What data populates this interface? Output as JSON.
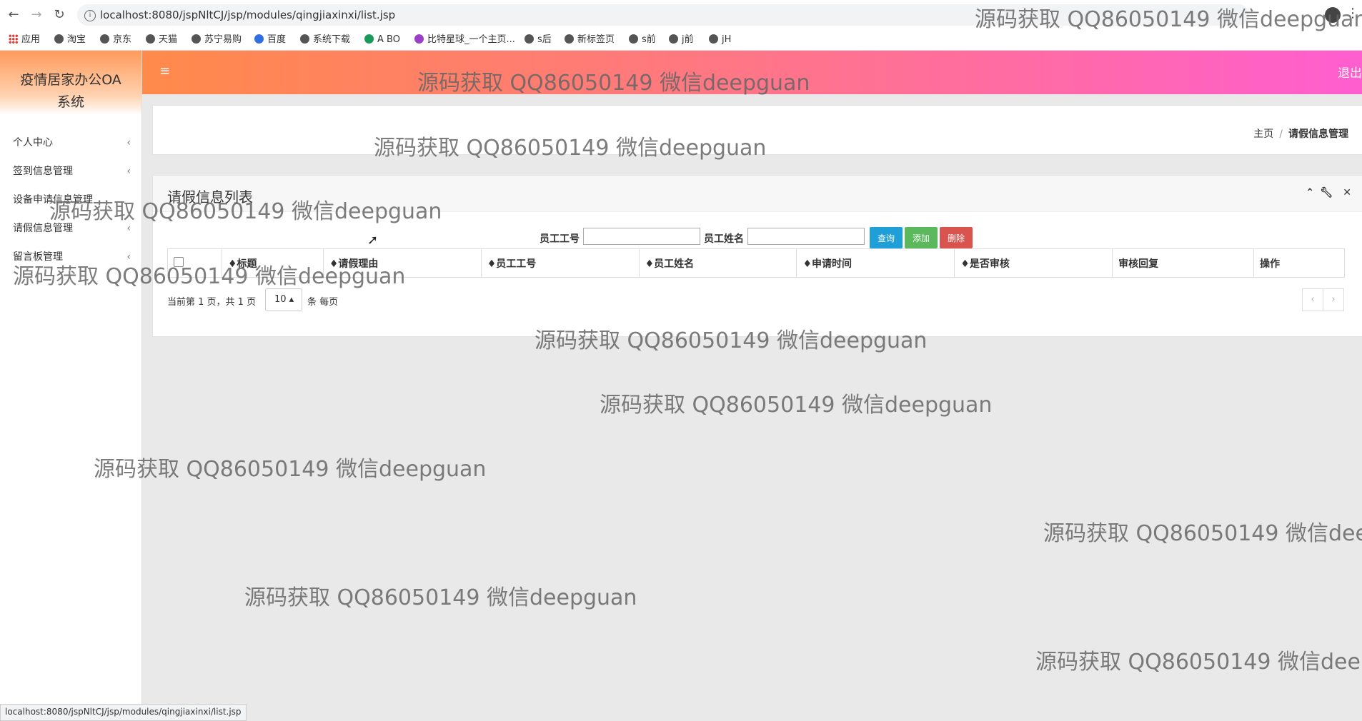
{
  "browser": {
    "url": "localhost:8080/jspNltCJ/jsp/modules/qingjiaxinxi/list.jsp",
    "status_url": "localhost:8080/jspNltCJ/jsp/modules/qingjiaxinxi/list.jsp",
    "bookmarks": [
      "应用",
      "淘宝",
      "京东",
      "天猫",
      "苏宁易购",
      "百度",
      "系统下载",
      "A BO",
      "比特星球_一个主页...",
      "s后",
      "新标签页",
      "s前",
      "j前",
      "jH"
    ]
  },
  "sidebar": {
    "brand": "疫情居家办公OA系统",
    "items": [
      {
        "label": "个人中心"
      },
      {
        "label": "签到信息管理"
      },
      {
        "label": "设备申请信息管理"
      },
      {
        "label": "请假信息管理"
      },
      {
        "label": "留言板管理"
      }
    ]
  },
  "topbar": {
    "menu_icon": "hamburger-icon",
    "logout": "退出"
  },
  "breadcrumb": {
    "home": "主页",
    "separator": "/",
    "current": "请假信息管理"
  },
  "list": {
    "title": "请假信息列表",
    "search": {
      "emp_no_label": "员工工号",
      "emp_name_label": "员工姓名",
      "emp_no_value": "",
      "emp_name_value": "",
      "search_btn": "查询",
      "add_btn": "添加",
      "delete_btn": "删除"
    },
    "columns": [
      "♦标题",
      "♦请假理由",
      "♦员工工号",
      "♦员工姓名",
      "♦申请时间",
      "♦是否审核",
      "审核回复",
      "操作"
    ],
    "rows": [],
    "pager": {
      "info": "当前第 1 页，共 1 页",
      "page_size": "10",
      "per_page": "条 每页",
      "prev": "‹",
      "next": "›"
    }
  },
  "watermark": "源码获取 QQ86050149 微信deepguan",
  "colors": {
    "topbar_start": "#ff8a4a",
    "topbar_end": "#ff5ed0",
    "search_btn": "#1e9fd8",
    "add_btn": "#5cb85c",
    "delete_btn": "#d9534f"
  }
}
